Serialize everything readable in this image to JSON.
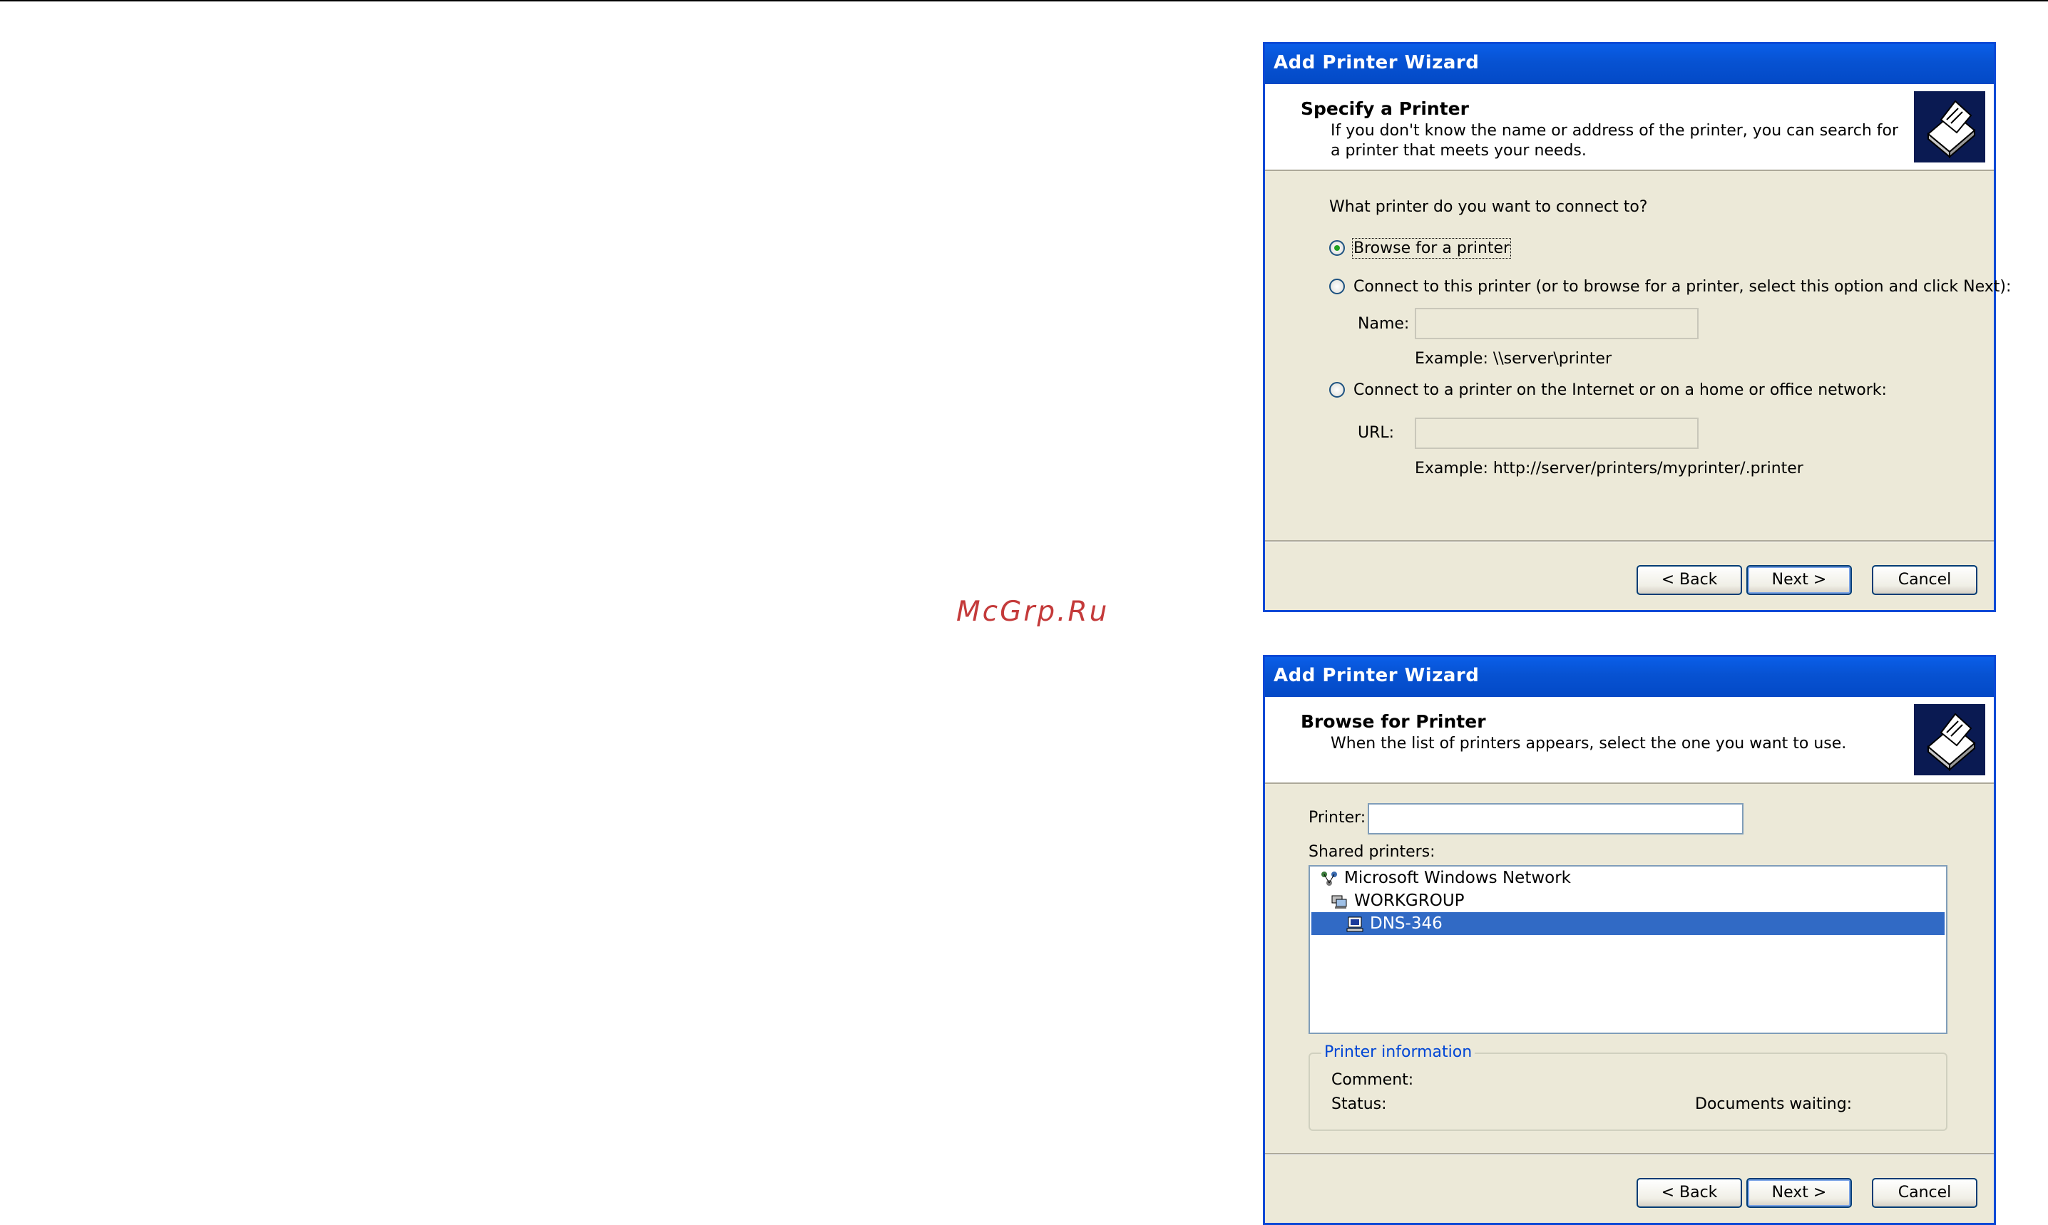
{
  "watermark": "McGrp.Ru",
  "wizard1": {
    "title": "Add Printer Wizard",
    "header_title": "Specify a Printer",
    "header_desc": "If you don't know the name or address of the printer, you can search for a printer that meets your needs.",
    "question": "What printer do you want to connect to?",
    "option_browse": "Browse for a printer",
    "option_connect": "Connect to this printer (or to browse for a printer, select this option and click Next):",
    "name_label": "Name:",
    "name_value": "",
    "name_example": "Example: \\\\server\\printer",
    "option_internet": "Connect to a printer on the Internet or on a home or office network:",
    "url_label": "URL:",
    "url_value": "",
    "url_example": "Example: http://server/printers/myprinter/.printer",
    "back_label": "< Back",
    "next_label": "Next >",
    "cancel_label": "Cancel"
  },
  "wizard2": {
    "title": "Add Printer Wizard",
    "header_title": "Browse for Printer",
    "header_desc": "When the list of printers appears, select the one you want to use.",
    "printer_label": "Printer:",
    "printer_value": "",
    "shared_label": "Shared printers:",
    "tree": [
      {
        "label": "Microsoft Windows Network",
        "icon": "network-icon"
      },
      {
        "label": "WORKGROUP",
        "icon": "workgroup-icon"
      },
      {
        "label": "DNS-346",
        "icon": "computer-icon"
      }
    ],
    "info_legend": "Printer information",
    "comment_label": "Comment:",
    "status_label": "Status:",
    "docs_waiting_label": "Documents waiting:",
    "back_label": "< Back",
    "next_label": "Next >",
    "cancel_label": "Cancel"
  },
  "colors": {
    "titlebar": "#0752d2",
    "selection": "#316ac5",
    "dialog_bg": "#ece9d8",
    "legend_text": "#0046d5",
    "watermark": "#c43a3a"
  }
}
